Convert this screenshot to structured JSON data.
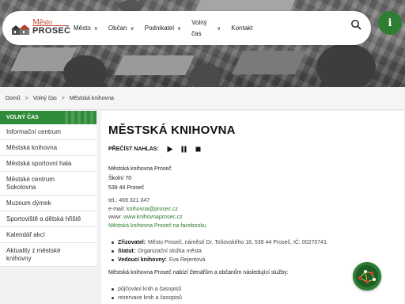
{
  "header": {
    "logo_top": "Město",
    "logo_bottom": "PROSEČ",
    "nav": [
      {
        "label": "Město"
      },
      {
        "label": "Občan"
      },
      {
        "label": "Podnikatel"
      },
      {
        "label": "Volný čas"
      },
      {
        "label": "Kontakt"
      }
    ],
    "info_label": "i"
  },
  "breadcrumb": {
    "items": [
      "Domů",
      "Volný čas",
      "Městská knihovna"
    ]
  },
  "sidebar": {
    "heading": "VOLNÝ ČAS",
    "items": [
      "Informační centrum",
      "Městská knihovna",
      "Městská sportovní hala",
      "Městské centrum Sokolovna",
      "Muzeum dýmek",
      "Sportoviště a dětská hřiště",
      "Kalendář akcí",
      "Aktuality z městské knihovny"
    ]
  },
  "main": {
    "title": "MĚSTSKÁ KNIHOVNA",
    "read_aloud": "PŘEČÍST NAHLAS:",
    "address": {
      "name": "Městská knihovna Proseč",
      "street": "Školní 70",
      "city": "539 44 Proseč"
    },
    "contact": {
      "tel_label": "tel.:",
      "tel": "469 321 047",
      "email_label": "e-mail:",
      "email": "knihovna@prosec.cz",
      "www_label": "www:",
      "www": "www.knihovnaprosec.cz",
      "facebook": "Městská knihovna Proseč na facebooku"
    },
    "facts": [
      {
        "label": "Zřizovatel:",
        "value": "Město Proseč, náměstí Dr. Tošovského 18, 539 44 Proseč, IČ: 00270741"
      },
      {
        "label": "Statut:",
        "value": "Organizační složka města"
      },
      {
        "label": "Vedoucí knihovny:",
        "value": "Eva Rejentová"
      }
    ],
    "intro": "Městská knihovna Proseč nabízí čtenářům a občanům následující služby:",
    "services": [
      "půjčování knih a časopisů",
      "rezervace knih a časopisů"
    ]
  },
  "colors": {
    "accent": "#2e7d32",
    "sidebar_heading": "#2e8b3a",
    "link": "#2a7a2e",
    "logo_red": "#c0392b"
  },
  "icons": [
    "house-logo-icon",
    "chevron-down-icon",
    "search-icon",
    "info-icon",
    "play-icon",
    "pause-icon",
    "stop-icon",
    "network-badge-icon"
  ]
}
